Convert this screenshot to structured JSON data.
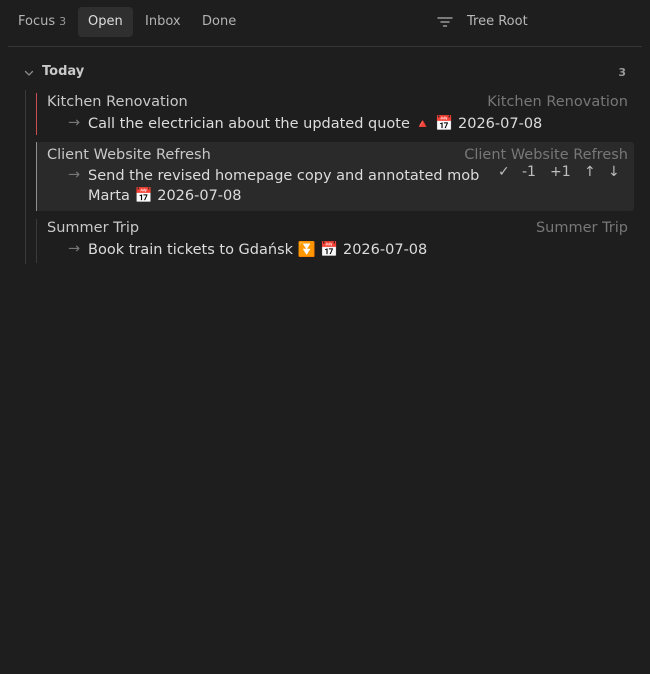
{
  "tabs": [
    {
      "label": "Focus",
      "count": "3"
    },
    {
      "label": "Open"
    },
    {
      "label": "Inbox"
    },
    {
      "label": "Done"
    }
  ],
  "header": {
    "tree_root": "Tree Root"
  },
  "section": {
    "title": "Today",
    "count": "3"
  },
  "groups": [
    {
      "project": "Kitchen Renovation",
      "project_right": "Kitchen Renovation",
      "arrow": "→",
      "task": "Call the electrician about the updated quote",
      "priority_icon": "🔺",
      "calendar_icon": "📅",
      "date": "2026-07-08",
      "accent_color": "#c94f4f"
    },
    {
      "project": "Client Website Refresh",
      "project_right": "Client Website Refresh",
      "arrow": "→",
      "task_line1": "Send the revised homepage copy and annotated mob",
      "task_line2_text": "Marta",
      "calendar_icon": "📅",
      "date": "2026-07-08",
      "accent_color": "#8f8f8f",
      "actions": {
        "done": "✓",
        "minus": "-1",
        "plus": "+1",
        "up": "↑",
        "down": "↓"
      }
    },
    {
      "project": "Summer Trip",
      "project_right": "Summer Trip",
      "arrow": "→",
      "task": "Book train tickets to Gdańsk",
      "priority_icon": "⏬",
      "calendar_icon": "📅",
      "date": "2026-07-08",
      "accent_color": "#3a3a3a"
    }
  ]
}
